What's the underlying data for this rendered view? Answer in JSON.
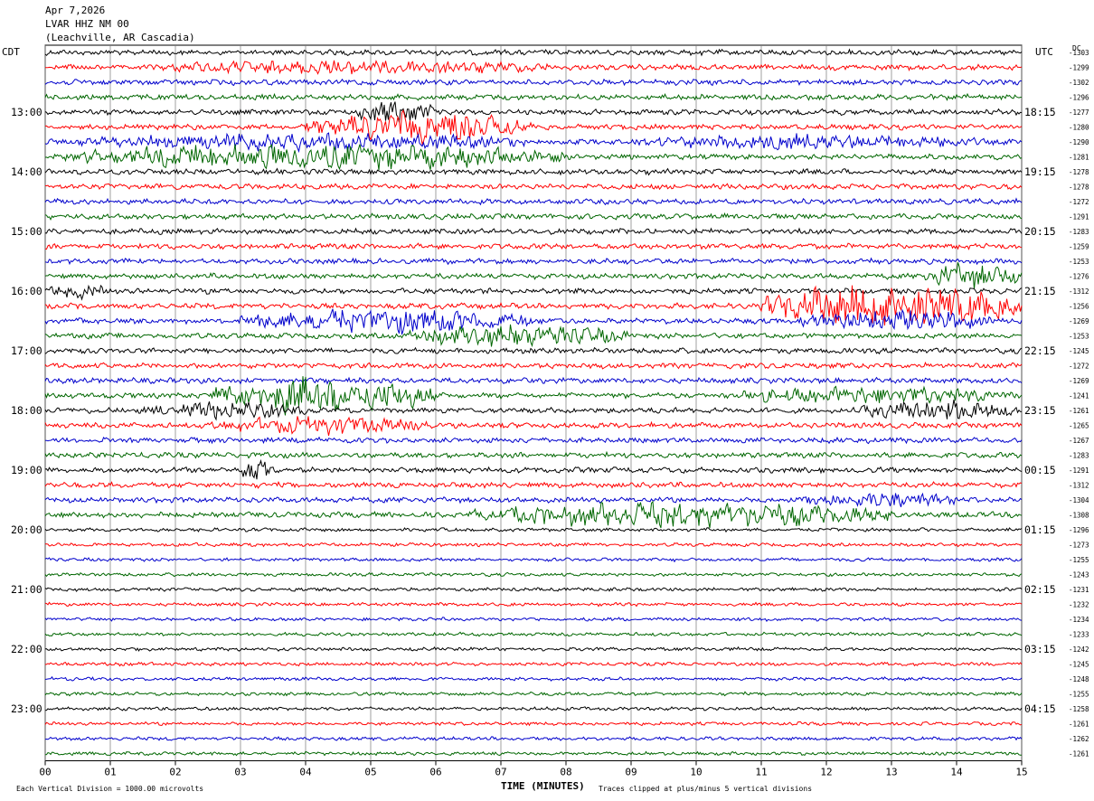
{
  "header": {
    "date": "Apr 7,2026",
    "station": "LVAR HHZ NM 00",
    "location": "(Leachville, AR Cascadia)"
  },
  "corner": {
    "left_tz": "CDT",
    "right_tz": "UTC",
    "dc_label": "DC"
  },
  "footer": {
    "scale_note": "Each Vertical Division = 1000.00 microvolts",
    "clip_note": "Traces clipped at plus/minus 5 vertical divisions",
    "xlabel": "TIME (MINUTES)"
  },
  "chart_data": {
    "type": "line",
    "title": "",
    "xlabel": "TIME (MINUTES)",
    "xlim": [
      0,
      15
    ],
    "x_ticks": [
      "00",
      "01",
      "02",
      "03",
      "04",
      "05",
      "06",
      "07",
      "08",
      "09",
      "10",
      "11",
      "12",
      "13",
      "14",
      "15"
    ],
    "row_count": 48,
    "rows_per_hour": 4,
    "colors": [
      "#000000",
      "#ff0000",
      "#0000cc",
      "#006600"
    ],
    "left_time_labels": [
      "13:00",
      "14:00",
      "15:00",
      "16:00",
      "17:00",
      "18:00",
      "19:00",
      "20:00",
      "21:00",
      "22:00",
      "23:00"
    ],
    "right_time_labels": [
      "18:15",
      "19:15",
      "20:15",
      "21:15",
      "22:15",
      "23:15",
      "00:15",
      "01:15",
      "02:15",
      "03:15",
      "04:15"
    ],
    "first_labeled_row": 4,
    "dc_offsets": [
      -1303,
      -1299,
      -1302,
      -1296,
      -1277,
      -1280,
      -1290,
      -1281,
      -1278,
      -1278,
      -1272,
      -1291,
      -1283,
      -1259,
      -1253,
      -1276,
      -1312,
      -1256,
      -1269,
      -1253,
      -1245,
      -1272,
      -1269,
      -1241,
      -1261,
      -1265,
      -1267,
      -1283,
      -1291,
      -1312,
      -1304,
      -1308,
      -1296,
      -1273,
      -1255,
      -1243,
      -1231,
      -1232,
      -1234,
      -1233,
      -1242,
      -1245,
      -1248,
      -1255,
      -1258,
      -1261,
      -1262,
      -1261
    ],
    "events": [
      {
        "row": 1,
        "start": 1.5,
        "end": 8.0,
        "amp": 2.0
      },
      {
        "row": 4,
        "start": 4.8,
        "end": 6.0,
        "amp": 3.5
      },
      {
        "row": 5,
        "start": 4.0,
        "end": 7.5,
        "amp": 4.0
      },
      {
        "row": 6,
        "start": 0.5,
        "end": 7.5,
        "amp": 2.5
      },
      {
        "row": 6,
        "start": 9.0,
        "end": 14.5,
        "amp": 2.2
      },
      {
        "row": 7,
        "start": 0.3,
        "end": 8.0,
        "amp": 3.5
      },
      {
        "row": 15,
        "start": 13.5,
        "end": 15.0,
        "amp": 3.5
      },
      {
        "row": 16,
        "start": 0.0,
        "end": 1.0,
        "amp": 2.0
      },
      {
        "row": 17,
        "start": 11.0,
        "end": 15.0,
        "amp": 6.0
      },
      {
        "row": 18,
        "start": 3.0,
        "end": 7.5,
        "amp": 3.5
      },
      {
        "row": 18,
        "start": 11.5,
        "end": 14.5,
        "amp": 3.0
      },
      {
        "row": 19,
        "start": 5.5,
        "end": 9.0,
        "amp": 3.0
      },
      {
        "row": 23,
        "start": 2.5,
        "end": 6.0,
        "amp": 5.0
      },
      {
        "row": 23,
        "start": 10.5,
        "end": 15.0,
        "amp": 2.5
      },
      {
        "row": 24,
        "start": 1.5,
        "end": 4.0,
        "amp": 2.5
      },
      {
        "row": 24,
        "start": 12.5,
        "end": 15.0,
        "amp": 3.0
      },
      {
        "row": 25,
        "start": 2.5,
        "end": 6.0,
        "amp": 2.5
      },
      {
        "row": 28,
        "start": 3.0,
        "end": 3.6,
        "amp": 3.0
      },
      {
        "row": 30,
        "start": 11.5,
        "end": 14.0,
        "amp": 2.5
      },
      {
        "row": 31,
        "start": 6.5,
        "end": 13.0,
        "amp": 3.5
      }
    ]
  }
}
